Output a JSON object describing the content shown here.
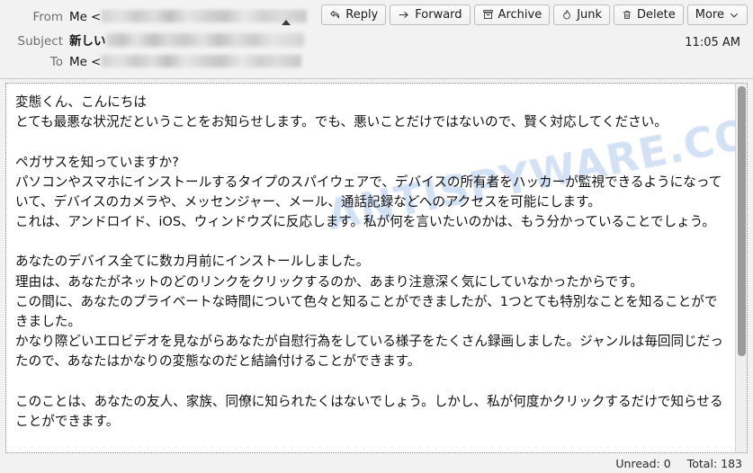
{
  "header": {
    "from_label": "From",
    "from_name": "Me",
    "from_open_bracket": "<",
    "from_address_redacted": "",
    "subject_label": "Subject",
    "subject_visible_prefix": "新しい",
    "subject_redacted": "",
    "to_label": "To",
    "to_name": "Me",
    "to_open_bracket": "<",
    "to_address_redacted": "",
    "time": "11:05 AM"
  },
  "toolbar": {
    "buttons": [
      {
        "label": "Reply",
        "icon": "reply-icon"
      },
      {
        "label": "Forward",
        "icon": "forward-arrow-icon"
      },
      {
        "label": "Archive",
        "icon": "archive-box-icon"
      },
      {
        "label": "Junk",
        "icon": "junk-flame-icon"
      },
      {
        "label": "Delete",
        "icon": "trash-icon"
      },
      {
        "label": "More",
        "icon": "chevron-down-icon"
      }
    ]
  },
  "message": {
    "watermark": "ANTISPYWARE.COM",
    "body": "変態くん、こんにちは\nとても最悪な状況だということをお知らせします。でも、悪いことだけではないので、賢く対応してください。\n\nペガサスを知っていますか?\nパソコンやスマホにインストールするタイプのスパイウェアで、デバイスの所有者をハッカーが監視できるようになっていて、デバイスのカメラや、メッセンジャー、メール、通話記録などへのアクセスを可能にします。\nこれは、アンドロイド、iOS、ウィンドウズに反応します。私が何を言いたいのかは、もう分かっていることでしょう。\n\nあなたのデバイス全てに数カ月前にインストールしました。\n理由は、あなたがネットのどのリンクをクリックするのか、あまり注意深く気にしていなかったからです。\nこの間に、あなたのプライベートな時間について色々と知ることができましたが、1つとても特別なことを知ることができました。\nかなり際どいエロビデオを見ながらあなたが自慰行為をしている様子をたくさん録画しました。ジャンルは毎回同じだったので、あなたはかなりの変態なのだと結論付けることができます。\n\nこのことは、あなたの友人、家族、同僚に知られたくはないでしょう。しかし、私が何度かクリックするだけで知らせることができます。"
  },
  "statusbar": {
    "unread": "Unread: 0",
    "total": "Total: 183"
  }
}
